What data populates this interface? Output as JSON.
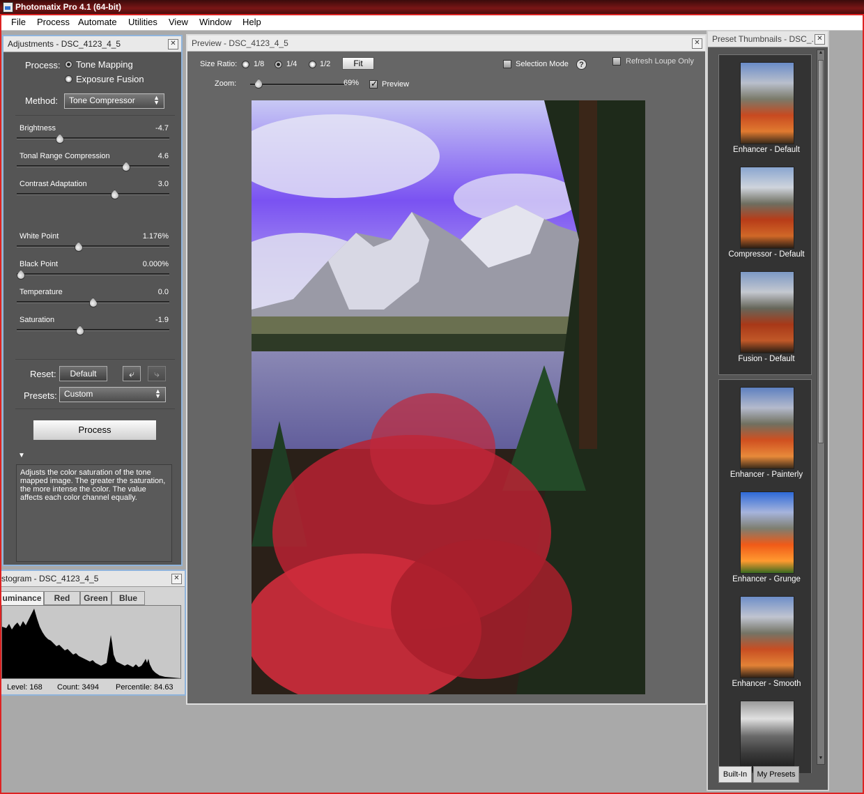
{
  "app": {
    "title": "Photomatix Pro 4.1 (64-bit)"
  },
  "menu": [
    "File",
    "Process",
    "Automate",
    "Utilities",
    "View",
    "Window",
    "Help"
  ],
  "adjustments": {
    "title": "Adjustments - DSC_4123_4_5",
    "process_label": "Process:",
    "process_options": [
      "Tone Mapping",
      "Exposure Fusion"
    ],
    "process_selected": "Tone Mapping",
    "method_label": "Method:",
    "method_value": "Tone Compressor",
    "sliders": [
      {
        "name": "Brightness",
        "value_text": "-4.7",
        "position": 0.27
      },
      {
        "name": "Tonal Range Compression",
        "value_text": "4.6",
        "position": 0.73
      },
      {
        "name": "Contrast Adaptation",
        "value_text": "3.0",
        "position": 0.65
      },
      {
        "name": "White Point",
        "value_text": "1.176%",
        "position": 0.4
      },
      {
        "name": "Black Point",
        "value_text": "0.000%",
        "position": 0.0
      },
      {
        "name": "Temperature",
        "value_text": "0.0",
        "position": 0.5
      },
      {
        "name": "Saturation",
        "value_text": "-1.9",
        "position": 0.41
      }
    ],
    "reset_label": "Reset:",
    "default_button": "Default",
    "presets_label": "Presets:",
    "presets_value": "Custom",
    "process_button": "Process",
    "help_text": "Adjusts the color saturation of the tone mapped image. The greater the saturation, the more intense the color. The value affects each color channel equally."
  },
  "histogram": {
    "title": "stogram - DSC_4123_4_5",
    "tabs": [
      "uminance",
      "Red",
      "Green",
      "Blue"
    ],
    "active_tab": "uminance",
    "status": {
      "level": "Level: 168",
      "count": "Count: 3494",
      "percentile": "Percentile: 84.63"
    }
  },
  "preview": {
    "title": "Preview - DSC_4123_4_5",
    "size_ratio_label": "Size Ratio:",
    "size_options": [
      "1/8",
      "1/4",
      "1/2"
    ],
    "fit_button": "Fit",
    "selection_mode": "Selection Mode",
    "help_icon": "?",
    "refresh_loupe": "Refresh Loupe Only",
    "zoom_label": "Zoom:",
    "zoom_value": "69%",
    "zoom_position": 0.05,
    "preview_checkbox": "Preview",
    "preview_checked": true
  },
  "thumbnails": {
    "title": "Preset Thumbnails - DSC_...",
    "group1": [
      "Enhancer - Default",
      "Compressor - Default",
      "Fusion - Default"
    ],
    "group2": [
      "Enhancer - Painterly",
      "Enhancer - Grunge",
      "Enhancer - Smooth"
    ],
    "tabs": [
      "Built-In",
      "My Presets"
    ]
  }
}
